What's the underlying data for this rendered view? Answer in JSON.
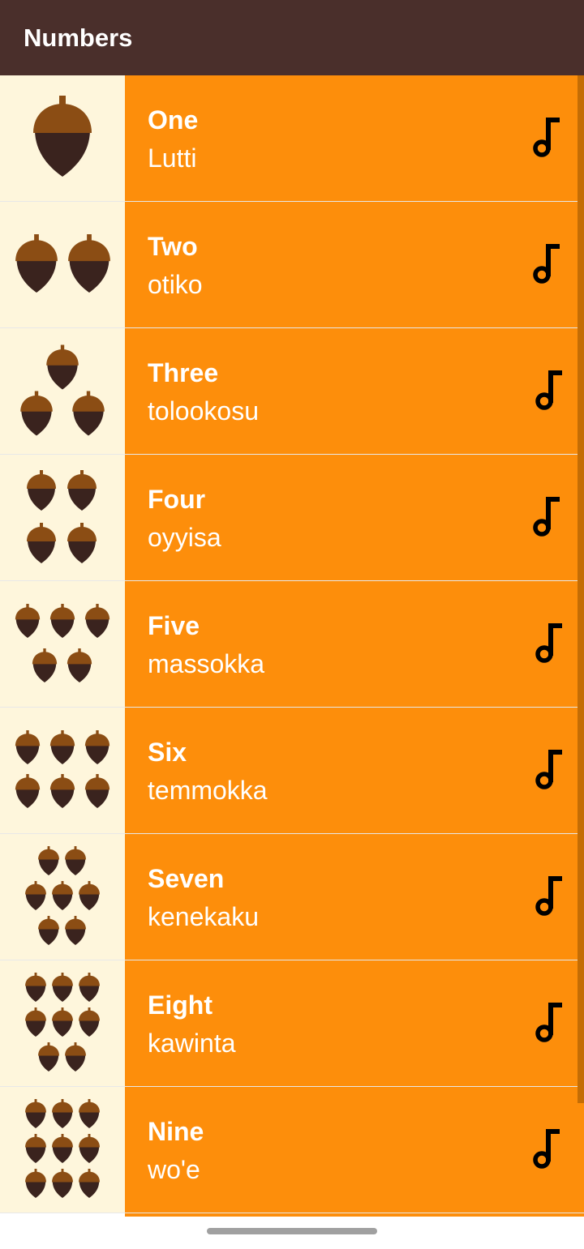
{
  "app_bar": {
    "title": "Numbers"
  },
  "colors": {
    "app_bar": "#4a2f2b",
    "text_panel": "#fd8e0b",
    "image_panel": "#fef6dc",
    "acorn_cap": "#8b4d14",
    "acorn_body": "#3a231e"
  },
  "play_icon": "music-note-icon",
  "items": [
    {
      "english": "One",
      "translation": "Lutti",
      "acorns": 1
    },
    {
      "english": "Two",
      "translation": "otiko",
      "acorns": 2
    },
    {
      "english": "Three",
      "translation": "tolookosu",
      "acorns": 3
    },
    {
      "english": "Four",
      "translation": "oyyisa",
      "acorns": 4
    },
    {
      "english": "Five",
      "translation": "massokka",
      "acorns": 5
    },
    {
      "english": "Six",
      "translation": "temmokka",
      "acorns": 6
    },
    {
      "english": "Seven",
      "translation": "kenekaku",
      "acorns": 7
    },
    {
      "english": "Eight",
      "translation": "kawinta",
      "acorns": 8
    },
    {
      "english": "Nine",
      "translation": "wo'e",
      "acorns": 9
    }
  ]
}
